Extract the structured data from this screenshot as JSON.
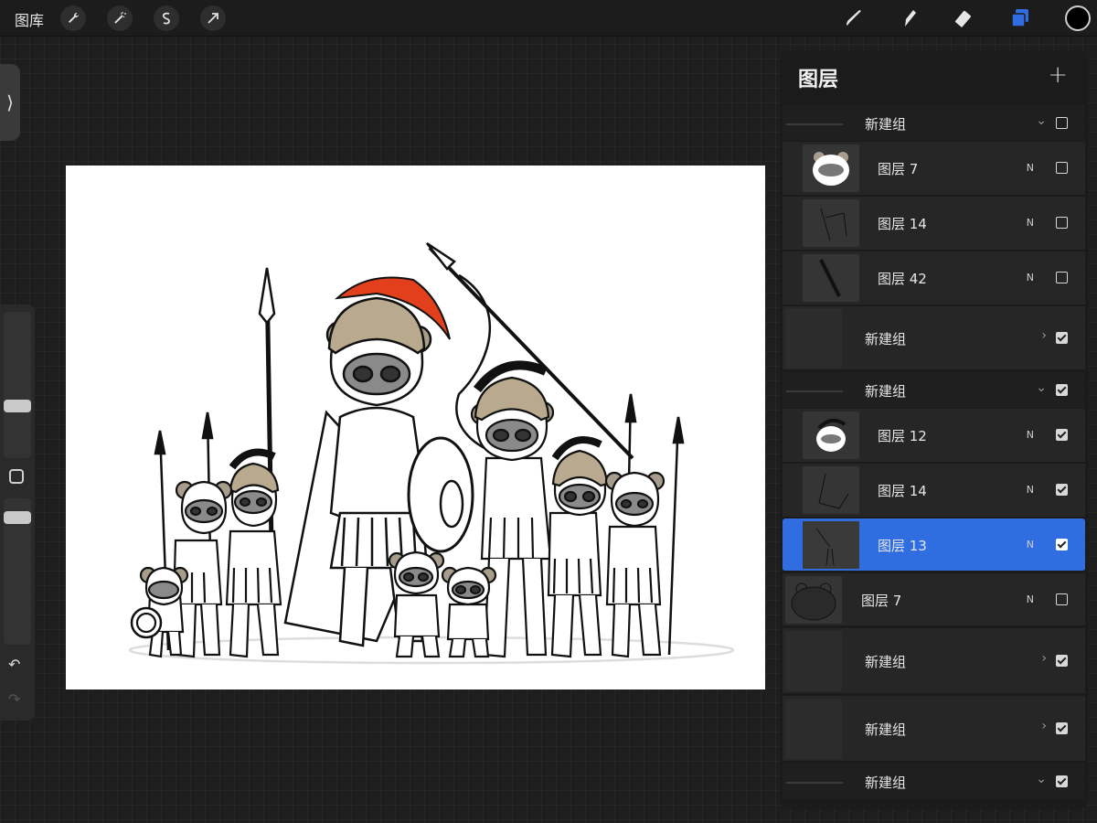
{
  "topbar": {
    "gallery_label": "图库",
    "left_tools": [
      "wrench-icon",
      "magic-wand-icon",
      "selection-icon",
      "move-arrow-icon"
    ],
    "right_tools": [
      "brush-icon",
      "smudge-icon",
      "eraser-icon",
      "layers-icon"
    ],
    "active_tool": "layers-icon",
    "accent_color": "#2f6de0",
    "current_color": "#000000"
  },
  "sidebar": {
    "handle_icon": "chevron-right-icon",
    "undo_icon": "undo-icon",
    "redo_icon": "redo-icon",
    "modify_icon": "square-icon"
  },
  "canvas": {
    "artwork": "raccoon-spartan-warriors",
    "accent_color": "#e2401c"
  },
  "layers": {
    "title": "图层",
    "add_icon": "plus-icon",
    "rows": [
      {
        "kind": "group-open",
        "label": "新建组",
        "checked": false
      },
      {
        "kind": "layer",
        "label": "图层 7",
        "blend": "N",
        "checked": false,
        "thumb": "raccoon-face"
      },
      {
        "kind": "layer",
        "label": "图层 14",
        "blend": "N",
        "checked": false,
        "thumb": "sketch-figure"
      },
      {
        "kind": "layer",
        "label": "图层 42",
        "blend": "N",
        "checked": false,
        "thumb": "sword"
      },
      {
        "kind": "group-closed",
        "label": "新建组",
        "checked": true
      },
      {
        "kind": "group-open",
        "label": "新建组",
        "checked": true
      },
      {
        "kind": "layer",
        "label": "图层 12",
        "blend": "N",
        "checked": true,
        "thumb": "helmet-raccoon"
      },
      {
        "kind": "layer",
        "label": "图层 14",
        "blend": "N",
        "checked": true,
        "thumb": "sketch-line"
      },
      {
        "kind": "layer",
        "label": "图层 13",
        "blend": "N",
        "checked": true,
        "thumb": "sketch-figure",
        "selected": true
      },
      {
        "kind": "layer",
        "label": "图层 7",
        "blend": "N",
        "checked": false,
        "thumb": "raccoon-outline"
      },
      {
        "kind": "group-closed",
        "label": "新建组",
        "checked": true
      },
      {
        "kind": "group-closed",
        "label": "新建组",
        "checked": true
      },
      {
        "kind": "group-open",
        "label": "新建组",
        "checked": true
      }
    ]
  }
}
